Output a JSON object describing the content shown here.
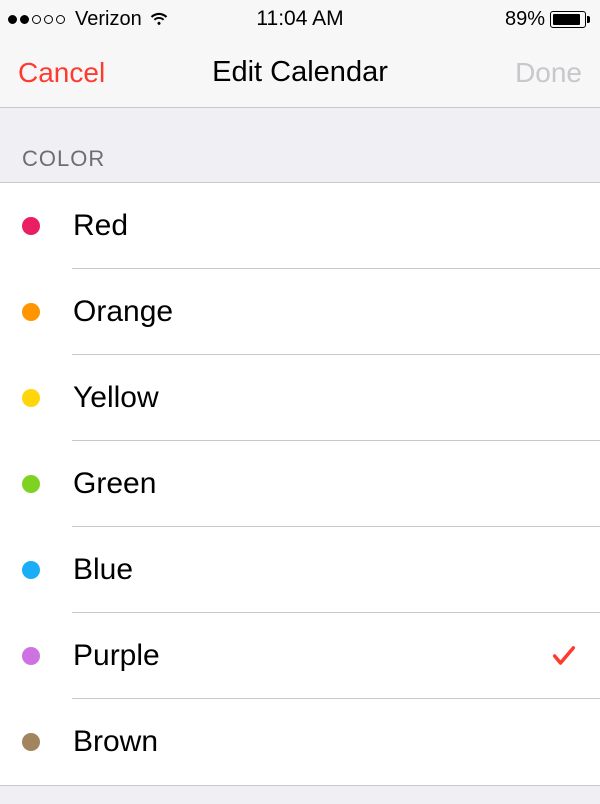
{
  "status_bar": {
    "carrier": "Verizon",
    "signal_strength": 2,
    "time": "11:04 AM",
    "battery_pct": "89%",
    "battery_level": 0.89
  },
  "nav": {
    "left": "Cancel",
    "title": "Edit Calendar",
    "right": "Done"
  },
  "section_header": "COLOR",
  "check_color": "#ff3b30",
  "colors": [
    {
      "label": "Red",
      "hex": "#e91e63",
      "selected": false
    },
    {
      "label": "Orange",
      "hex": "#ff9500",
      "selected": false
    },
    {
      "label": "Yellow",
      "hex": "#ffd60a",
      "selected": false
    },
    {
      "label": "Green",
      "hex": "#7ed321",
      "selected": false
    },
    {
      "label": "Blue",
      "hex": "#1badf8",
      "selected": false
    },
    {
      "label": "Purple",
      "hex": "#cc73e1",
      "selected": true
    },
    {
      "label": "Brown",
      "hex": "#a2845e",
      "selected": false
    }
  ]
}
